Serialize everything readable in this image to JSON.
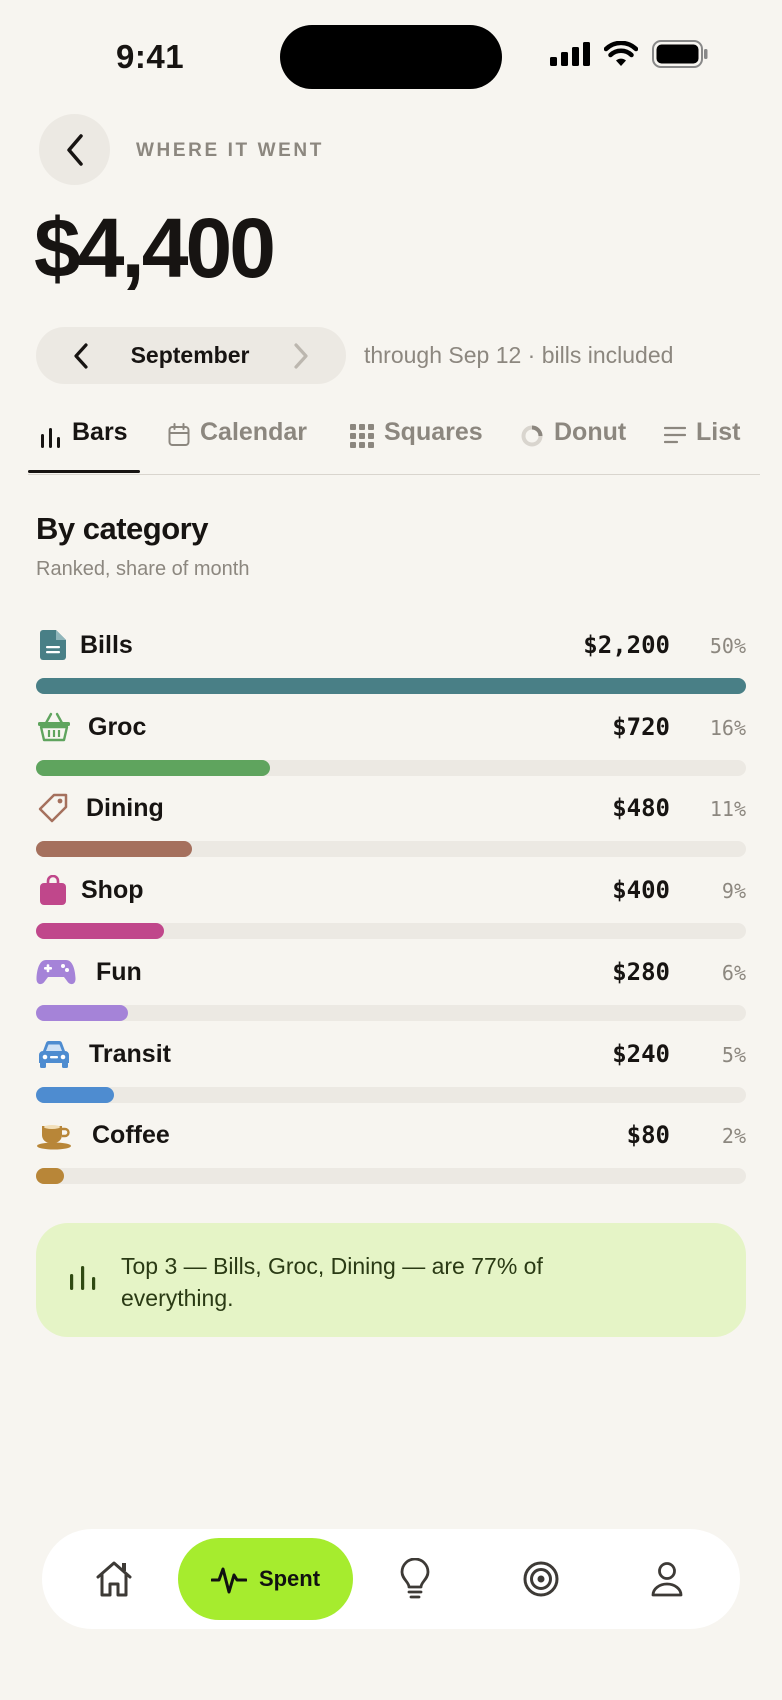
{
  "status_bar": {
    "time": "9:41"
  },
  "header": {
    "eyebrow": "WHERE IT WENT",
    "total": "$4,400"
  },
  "period": {
    "month": "September",
    "note": "through Sep 12 · bills included"
  },
  "tabs": [
    {
      "label": "Bars",
      "icon": "bar-chart-icon",
      "active": true
    },
    {
      "label": "Calendar",
      "icon": "calendar-icon",
      "active": false
    },
    {
      "label": "Squares",
      "icon": "grid-icon",
      "active": false
    },
    {
      "label": "Donut",
      "icon": "donut-icon",
      "active": false
    },
    {
      "label": "List",
      "icon": "list-icon",
      "active": false
    }
  ],
  "section": {
    "title": "By category",
    "subtitle": "Ranked, share of month"
  },
  "categories": [
    {
      "name": "Bills",
      "amount": "$2,200",
      "percent": "50%",
      "share": 1.0,
      "color": "#497f86",
      "icon": "document-icon"
    },
    {
      "name": "Groc",
      "amount": "$720",
      "percent": "16%",
      "share": 0.33,
      "color": "#5fa45e",
      "icon": "basket-icon"
    },
    {
      "name": "Dining",
      "amount": "$480",
      "percent": "11%",
      "share": 0.22,
      "color": "#a5705d",
      "icon": "tag-icon"
    },
    {
      "name": "Shop",
      "amount": "$400",
      "percent": "9%",
      "share": 0.18,
      "color": "#c0478b",
      "icon": "shopping-bag-icon"
    },
    {
      "name": "Fun",
      "amount": "$280",
      "percent": "6%",
      "share": 0.13,
      "color": "#a583d8",
      "icon": "gamepad-icon"
    },
    {
      "name": "Transit",
      "amount": "$240",
      "percent": "5%",
      "share": 0.11,
      "color": "#4e8cd0",
      "icon": "car-icon"
    },
    {
      "name": "Coffee",
      "amount": "$80",
      "percent": "2%",
      "share": 0.04,
      "color": "#b88638",
      "icon": "coffee-cup-icon"
    }
  ],
  "insight": {
    "text": "Top 3 — Bills, Groc, Dining — are 77% of everything."
  },
  "nav": {
    "active_label": "Spent"
  }
}
